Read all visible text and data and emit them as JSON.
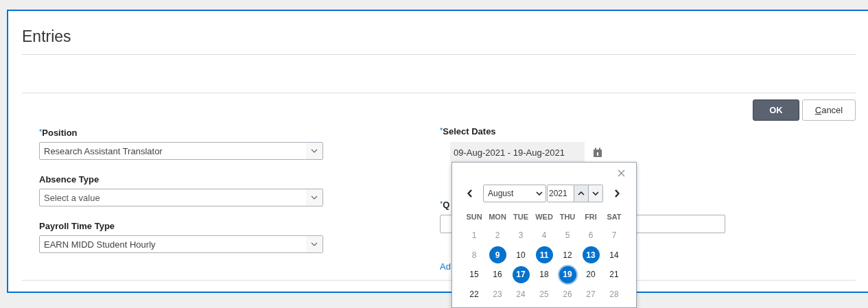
{
  "dialog": {
    "title": "Entries"
  },
  "buttons": [
    {
      "label": "OK",
      "kind": "primary",
      "access_key_underlined": false
    },
    {
      "label": "Cancel",
      "kind": "secondary",
      "access_key_underlined": true
    }
  ],
  "left_fields": [
    {
      "required_mark": "*",
      "label": "Position",
      "value": "Research Assistant Translator"
    },
    {
      "label": "Absence Type",
      "placeholder": "Select a value"
    },
    {
      "label": "Payroll Time Type",
      "value": "EARN MIDD Student Hourly"
    }
  ],
  "select_dates": {
    "required_mark": "*",
    "label": "Select Dates",
    "value": "09-Aug-2021 - 19-Aug-2021"
  },
  "field_2": {
    "required_mark": "*",
    "label": "Q"
  },
  "link": "Ad",
  "calendar": {
    "month": "August",
    "year": "2021",
    "weekdays": [
      "SUN",
      "MON",
      "TUE",
      "WED",
      "THU",
      "FRI",
      "SAT"
    ],
    "weeks": [
      [
        {
          "day": "1",
          "disabled": true,
          "selected": false,
          "focused": false
        },
        {
          "day": "2",
          "disabled": true,
          "selected": false,
          "focused": false
        },
        {
          "day": "3",
          "disabled": true,
          "selected": false,
          "focused": false
        },
        {
          "day": "4",
          "disabled": true,
          "selected": false,
          "focused": false
        },
        {
          "day": "5",
          "disabled": true,
          "selected": false,
          "focused": false
        },
        {
          "day": "6",
          "disabled": true,
          "selected": false,
          "focused": false
        },
        {
          "day": "7",
          "disabled": true,
          "selected": false,
          "focused": false
        }
      ],
      [
        {
          "day": "8",
          "disabled": true,
          "selected": false,
          "focused": false
        },
        {
          "day": "9",
          "disabled": false,
          "selected": true,
          "focused": false
        },
        {
          "day": "10",
          "disabled": false,
          "selected": false,
          "focused": false
        },
        {
          "day": "11",
          "disabled": false,
          "selected": true,
          "focused": false
        },
        {
          "day": "12",
          "disabled": false,
          "selected": false,
          "focused": false
        },
        {
          "day": "13",
          "disabled": false,
          "selected": true,
          "focused": false
        },
        {
          "day": "14",
          "disabled": false,
          "selected": false,
          "focused": false
        }
      ],
      [
        {
          "day": "15",
          "disabled": false,
          "selected": false,
          "focused": false
        },
        {
          "day": "16",
          "disabled": false,
          "selected": false,
          "focused": false
        },
        {
          "day": "17",
          "disabled": false,
          "selected": true,
          "focused": false
        },
        {
          "day": "18",
          "disabled": false,
          "selected": false,
          "focused": false
        },
        {
          "day": "19",
          "disabled": false,
          "selected": true,
          "focused": true
        },
        {
          "day": "20",
          "disabled": false,
          "selected": false,
          "focused": false
        },
        {
          "day": "21",
          "disabled": false,
          "selected": false,
          "focused": false
        }
      ],
      [
        {
          "day": "22",
          "disabled": false,
          "selected": false,
          "focused": false
        },
        {
          "day": "23",
          "disabled": true,
          "selected": false,
          "focused": false
        },
        {
          "day": "24",
          "disabled": true,
          "selected": false,
          "focused": false
        },
        {
          "day": "25",
          "disabled": true,
          "selected": false,
          "focused": false
        },
        {
          "day": "26",
          "disabled": true,
          "selected": false,
          "focused": false
        },
        {
          "day": "27",
          "disabled": true,
          "selected": false,
          "focused": false
        },
        {
          "day": "28",
          "disabled": true,
          "selected": false,
          "focused": false
        }
      ]
    ]
  }
}
